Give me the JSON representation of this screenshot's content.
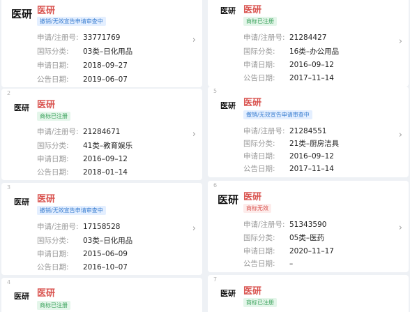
{
  "labels": {
    "reg_no": "申请/注册号:",
    "class": "国际分类:",
    "apply_date": "申请日期:",
    "pub_date": "公告日期:"
  },
  "colors": {
    "name_red": "#d9534f",
    "status_blue": "#3a7ed0",
    "status_green": "#3da35d",
    "background": "#eef1f5"
  },
  "chevron_icon": "chevron-right-icon",
  "records": [
    {
      "index": "",
      "logo": "医研",
      "name": "医研",
      "status": "撤销/无效宣告申请审查中",
      "status_color": "blue",
      "reg_no": "33771769",
      "class": "03类–日化用品",
      "apply_date": "2018–09–27",
      "pub_date": "2019–06–07"
    },
    {
      "index": "2",
      "logo": "医研",
      "name": "医研",
      "status": "商标已注册",
      "status_color": "green",
      "reg_no": "21284671",
      "class": "41类–教育娱乐",
      "apply_date": "2016–09–12",
      "pub_date": "2018–01–14"
    },
    {
      "index": "3",
      "logo": "医研",
      "name": "医研",
      "status": "撤销/无效宣告申请审查中",
      "status_color": "blue",
      "reg_no": "17158528",
      "class": "03类–日化用品",
      "apply_date": "2015–06–09",
      "pub_date": "2016–10–07"
    },
    {
      "index": "4",
      "logo": "医研",
      "name": "医研",
      "status": "商标已注册",
      "status_color": "green"
    },
    {
      "index": "",
      "logo": "医研",
      "name": "医研",
      "status": "商标已注册",
      "status_color": "green",
      "reg_no": "21284427",
      "class": "16类–办公用品",
      "apply_date": "2016–09–12",
      "pub_date": "2017–11–14"
    },
    {
      "index": "5",
      "logo": "医研",
      "name": "医研",
      "status": "撤销/无效宣告申请审查中",
      "status_color": "blue",
      "reg_no": "21284551",
      "class": "21类–厨房洁具",
      "apply_date": "2016–09–12",
      "pub_date": "2017–11–14"
    },
    {
      "index": "6",
      "logo": "医研",
      "name": "医研",
      "status": "商标无效",
      "status_color": "red",
      "reg_no": "51343590",
      "class": "05类–医药",
      "apply_date": "2020–11–17",
      "pub_date": "–"
    },
    {
      "index": "7",
      "logo": "医研",
      "name": "医研",
      "status": "商标已注册",
      "status_color": "green"
    }
  ]
}
